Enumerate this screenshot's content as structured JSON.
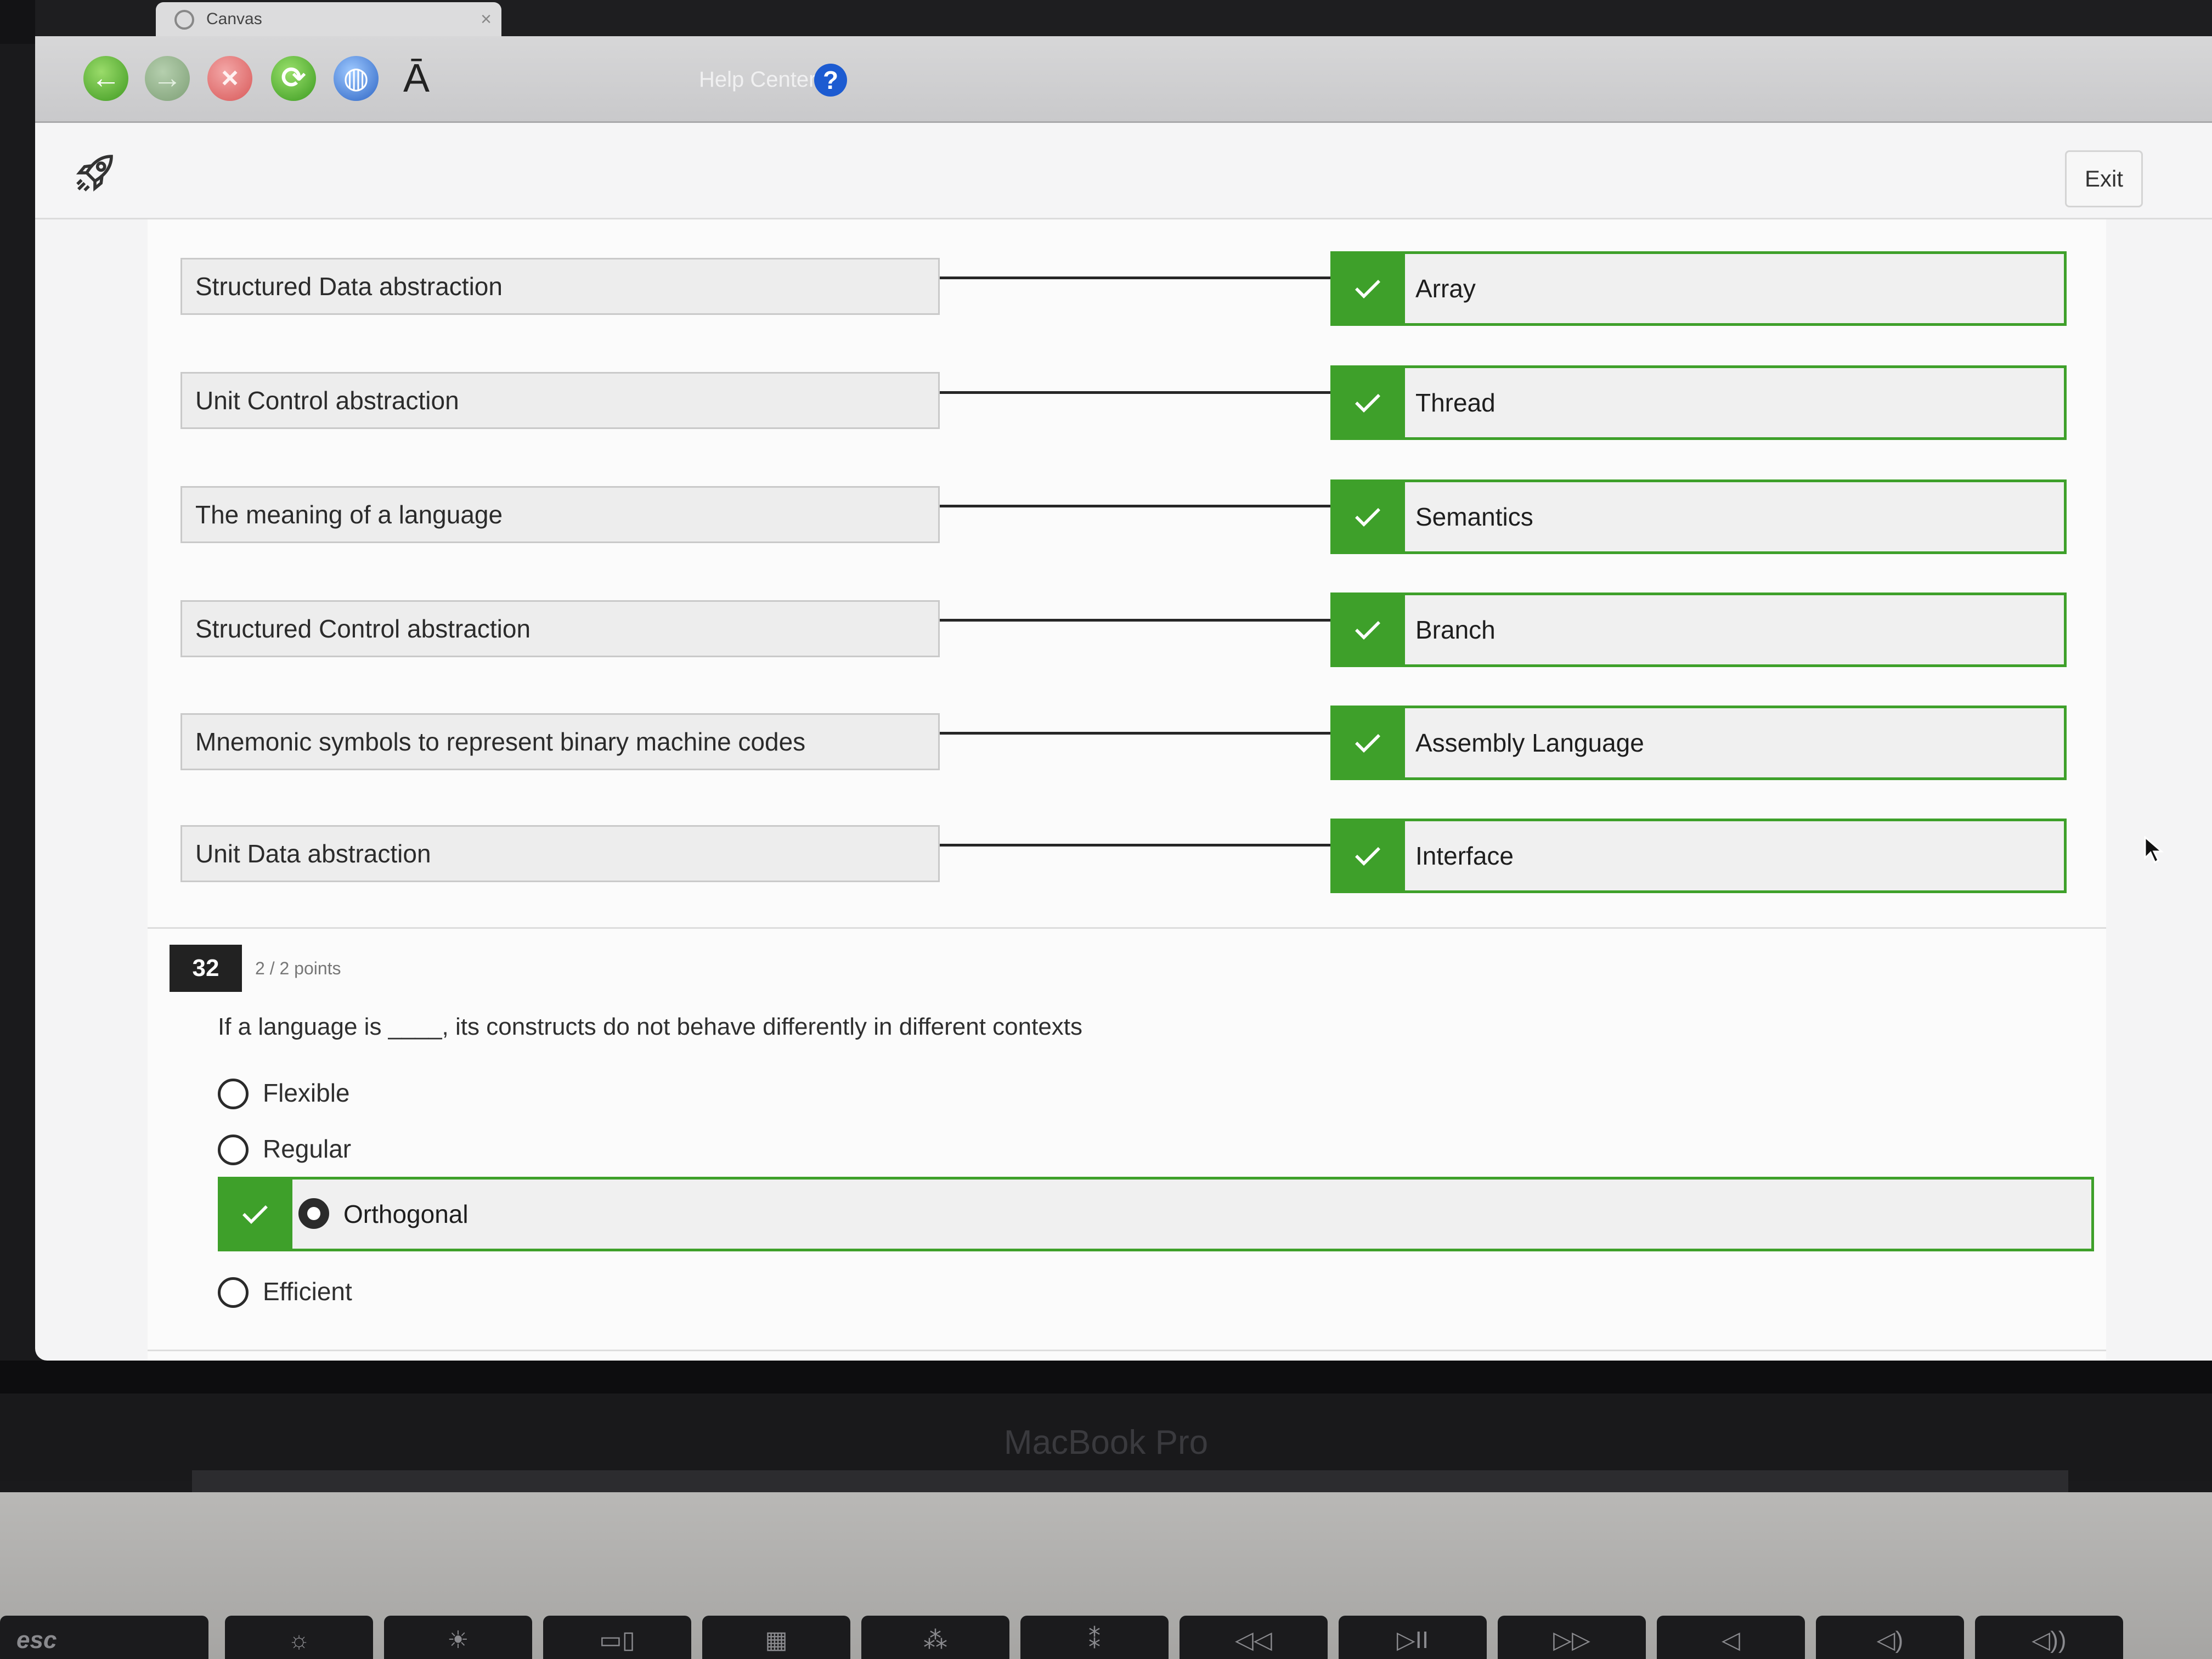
{
  "browser": {
    "tab_title": "Canvas",
    "tab_close": "×",
    "help_center": "Help Center",
    "help_icon_glyph": "?",
    "text_size_glyph": "Ā",
    "back_glyph": "←",
    "forward_glyph": "→",
    "stop_glyph": "×",
    "reload_glyph": "⟳",
    "globe_glyph": "◍"
  },
  "header": {
    "exit_label": "Exit"
  },
  "matching": {
    "rows": [
      {
        "term": "Structured Data abstraction",
        "answer": "Array",
        "correct": true
      },
      {
        "term": "Unit Control abstraction",
        "answer": "Thread",
        "correct": true
      },
      {
        "term": "The meaning of a language",
        "answer": "Semantics",
        "correct": true
      },
      {
        "term": "Structured Control abstraction",
        "answer": "Branch",
        "correct": true
      },
      {
        "term": "Mnemonic symbols to represent binary machine codes",
        "answer": "Assembly Language",
        "correct": true
      },
      {
        "term": "Unit Data abstraction",
        "answer": "Interface",
        "correct": true
      }
    ]
  },
  "question": {
    "number": "32",
    "points": "2 / 2 points",
    "text": "If a language is ____, its constructs do not behave differently in different contexts",
    "options": [
      {
        "label": "Flexible",
        "selected": false
      },
      {
        "label": "Regular",
        "selected": false
      },
      {
        "label": "Orthogonal",
        "selected": true,
        "correct": true
      },
      {
        "label": "Efficient",
        "selected": false
      }
    ]
  },
  "device": {
    "brand": "MacBook Pro",
    "keys": [
      "esc",
      "☼",
      "☀",
      "▭▯",
      "▦",
      "⁂",
      "⁑",
      "◁◁",
      "▷II",
      "▷▷",
      "◁",
      "◁)",
      "◁))"
    ]
  },
  "colors": {
    "correct_green": "#3ea02a",
    "question_badge": "#222222"
  }
}
